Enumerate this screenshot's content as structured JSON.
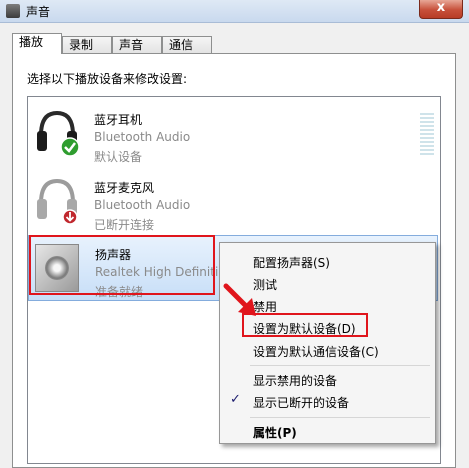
{
  "window": {
    "title": "声音",
    "close_glyph": "x"
  },
  "tabs": [
    {
      "label": "播放",
      "active": true
    },
    {
      "label": "录制"
    },
    {
      "label": "声音"
    },
    {
      "label": "通信"
    }
  ],
  "instruction": "选择以下播放设备来修改设置:",
  "devices": [
    {
      "name": "蓝牙耳机",
      "desc": "Bluetooth Audio",
      "status": "默认设备",
      "icon": "headphones-icon",
      "badge": "green-check"
    },
    {
      "name": "蓝牙麦克风",
      "desc": "Bluetooth Audio",
      "status": "已断开连接",
      "icon": "headphones-icon",
      "badge": "red-down-arrow"
    },
    {
      "name": "扬声器",
      "desc": "Realtek High Definiti",
      "status": "准备就绪",
      "icon": "speaker-icon"
    }
  ],
  "context_menu": {
    "items": [
      {
        "label": "配置扬声器(S)"
      },
      {
        "label": "测试"
      },
      {
        "label": "禁用"
      },
      {
        "label": "设置为默认设备(D)",
        "highlighted": true
      },
      {
        "label": "设置为默认通信设备(C)"
      },
      {
        "label": "显示禁用的设备"
      },
      {
        "label": "显示已断开的设备",
        "checked": true,
        "check_glyph": "✓"
      },
      {
        "label": "属性(P)",
        "bold": true
      }
    ]
  },
  "colors": {
    "annotation_red": "#e0151c",
    "selection_blue": "#c7def7"
  }
}
